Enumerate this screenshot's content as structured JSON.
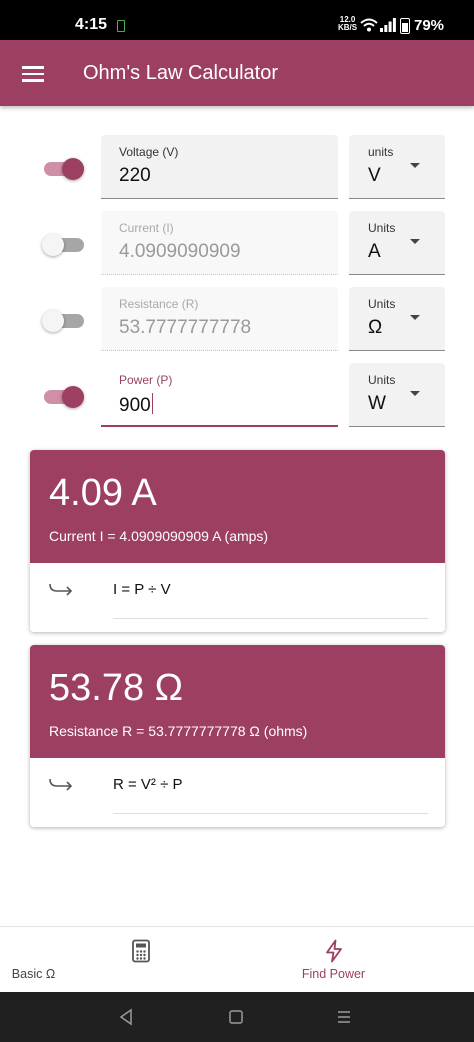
{
  "status": {
    "time": "4:15",
    "net_speed": "12.0",
    "net_unit": "KB/S",
    "battery": "79%"
  },
  "app": {
    "title": "Ohm's Law Calculator"
  },
  "inputs": [
    {
      "label": "Voltage (V)",
      "value": "220",
      "units_label": "units",
      "unit": "V",
      "toggle": "on",
      "state": "normal"
    },
    {
      "label": "Current (I)",
      "value": "4.0909090909",
      "units_label": "Units",
      "unit": "A",
      "toggle": "off",
      "state": "disabled"
    },
    {
      "label": "Resistance (R)",
      "value": "53.7777777778",
      "units_label": "Units",
      "unit": "Ω",
      "toggle": "off",
      "state": "disabled"
    },
    {
      "label": "Power (P)",
      "value": "900",
      "units_label": "Units",
      "unit": "W",
      "toggle": "on",
      "state": "focused"
    }
  ],
  "results": [
    {
      "big": "4.09 A",
      "sub": "Current I = 4.0909090909 A (amps)",
      "formula": "I = P ÷ V"
    },
    {
      "big": "53.78 Ω",
      "sub": "Resistance R = 53.7777777778 Ω (ohms)",
      "formula": "R = V² ÷ P"
    }
  ],
  "nav": [
    {
      "label": "Basic Ω",
      "icon": "calculator-icon",
      "active": false
    },
    {
      "label": "Find Power",
      "icon": "lightning-icon",
      "active": true
    }
  ],
  "colors": {
    "primary": "#9c3f62",
    "toggle_track_on": "#cf8fa7"
  }
}
